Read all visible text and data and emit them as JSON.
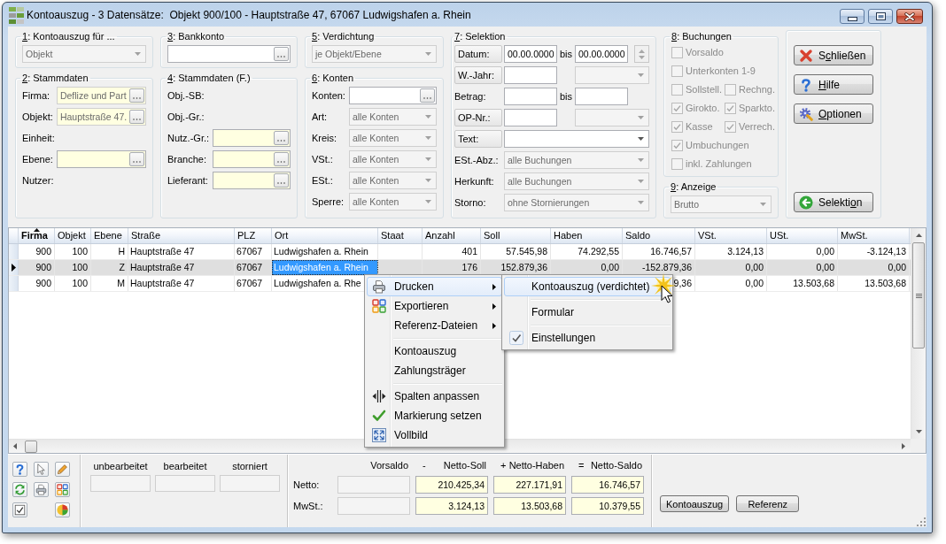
{
  "window": {
    "title": "Kontoauszug - 3 Datensätze:  Objekt 900/100 - Hauptstraße 47, 67067 Ludwigshafen a. Rhein"
  },
  "filter_columns": [
    {
      "groups": [
        {
          "title": {
            "key": "1",
            "post": ": Kontoauszug für ..."
          },
          "rows": [
            {
              "kind": "dropdown",
              "value": "Objekt",
              "disabled": true
            }
          ]
        },
        {
          "title": {
            "key": "2",
            "post": ": Stammdaten"
          },
          "rows": [
            {
              "kind": "lookup",
              "label": "Firma:",
              "value": "Deflize und Part",
              "highlighted": true,
              "disabled": true
            },
            {
              "kind": "lookup",
              "label": "Objekt:",
              "value": "Hauptstraße 47.",
              "highlighted": true,
              "disabled": true
            },
            {
              "kind": "label",
              "label": "Einheit:"
            },
            {
              "kind": "lookup",
              "label": "Ebene:",
              "highlighted": true,
              "disabled": false
            },
            {
              "kind": "label",
              "label": "Nutzer:"
            }
          ]
        }
      ]
    },
    {
      "groups": [
        {
          "title": {
            "key": "3",
            "post": ": Bankkonto"
          },
          "rows": [
            {
              "kind": "lookup",
              "highlighted": false,
              "disabled": false
            }
          ]
        },
        {
          "title": {
            "key": "4",
            "post": ": Stammdaten (F.)"
          },
          "rows": [
            {
              "kind": "label",
              "label": "Obj.-SB:"
            },
            {
              "kind": "label",
              "label": "Obj.-Gr.:"
            },
            {
              "kind": "lookup",
              "label": "Nutz.-Gr.:",
              "highlighted": true,
              "disabled": false
            },
            {
              "kind": "lookup",
              "label": "Branche:",
              "highlighted": true,
              "disabled": false
            },
            {
              "kind": "lookup",
              "label": "Lieferant:",
              "highlighted": true,
              "disabled": false
            }
          ]
        }
      ]
    },
    {
      "groups": [
        {
          "title": {
            "key": "5",
            "post": ": Verdichtung"
          },
          "rows": [
            {
              "kind": "dropdown",
              "value": "je Objekt/Ebene",
              "disabled": true
            }
          ]
        },
        {
          "title": {
            "key": "6",
            "post": ": Konten"
          },
          "rows": [
            {
              "kind": "lookup",
              "label": "Konten:",
              "highlighted": false,
              "disabled": false
            },
            {
              "kind": "dropdown",
              "label": "Art:",
              "value": "alle Konten",
              "disabled": true
            },
            {
              "kind": "dropdown",
              "label": "Kreis:",
              "value": "alle Konten",
              "disabled": true
            },
            {
              "kind": "dropdown",
              "label": "VSt.:",
              "value": "alle Konten",
              "disabled": true
            },
            {
              "kind": "dropdown",
              "label": "ESt.:",
              "value": "alle Konten",
              "disabled": true
            },
            {
              "kind": "dropdown",
              "label": "Sperre:",
              "value": "alle Konten",
              "disabled": true
            }
          ]
        }
      ]
    },
    {
      "groups": [
        {
          "title": {
            "key": "7",
            "post": ": Selektion"
          },
          "rows": [
            {
              "kind": "selection",
              "label": "Datum:",
              "label_button": true,
              "fields": [
                {
                  "kind": "text",
                  "value": "00.00.0000"
                },
                {
                  "kind": "until",
                  "text": "bis"
                },
                {
                  "kind": "text",
                  "value": "00.00.0000"
                },
                {
                  "kind": "spinner",
                  "disabled": true
                }
              ]
            },
            {
              "kind": "selection",
              "label": "W.-Jahr:",
              "label_button": true,
              "fields": [
                {
                  "kind": "text"
                },
                {
                  "kind": "dropdown",
                  "disabled": true
                }
              ]
            },
            {
              "kind": "selection",
              "label": "Betrag:",
              "label_button": false,
              "fields": [
                {
                  "kind": "text"
                },
                {
                  "kind": "until",
                  "text": "bis"
                },
                {
                  "kind": "text"
                }
              ]
            },
            {
              "kind": "selection",
              "label": "OP-Nr.:",
              "label_button": true,
              "fields": [
                {
                  "kind": "text"
                },
                {
                  "kind": "dropdown",
                  "disabled": true
                }
              ]
            },
            {
              "kind": "selection",
              "label": "Text:",
              "label_button": true,
              "fields": [
                {
                  "kind": "dropdown",
                  "disabled": false
                }
              ]
            },
            {
              "kind": "selection",
              "label": "ESt.-Abz.:",
              "label_button": false,
              "fields": [
                {
                  "kind": "dropdown",
                  "value": "alle Buchungen",
                  "disabled": true
                }
              ]
            },
            {
              "kind": "selection",
              "label": "Herkunft:",
              "label_button": false,
              "fields": [
                {
                  "kind": "dropdown",
                  "value": "alle Buchungen",
                  "disabled": true
                }
              ]
            },
            {
              "kind": "selection",
              "label": "Storno:",
              "label_button": false,
              "fields": [
                {
                  "kind": "dropdown",
                  "value": "ohne Stornierungen",
                  "disabled": true
                }
              ]
            }
          ]
        }
      ]
    },
    {
      "groups": [
        {
          "title": {
            "key": "8",
            "post": ": Buchungen"
          },
          "rows": [
            {
              "kind": "checks",
              "items": [
                {
                  "label": "Vorsaldo",
                  "checked": false,
                  "disabled": true
                }
              ]
            },
            {
              "kind": "checks",
              "items": [
                {
                  "label": "Unterkonten 1-9",
                  "checked": false,
                  "disabled": true
                }
              ]
            },
            {
              "kind": "checks",
              "items": [
                {
                  "label": "Sollstell.",
                  "checked": false,
                  "disabled": true
                },
                {
                  "label": "Rechng.",
                  "checked": false,
                  "disabled": true
                }
              ]
            },
            {
              "kind": "checks",
              "items": [
                {
                  "label": "Girokto.",
                  "checked": true,
                  "disabled": true
                },
                {
                  "label": "Sparkto.",
                  "checked": true,
                  "disabled": true
                }
              ]
            },
            {
              "kind": "checks",
              "items": [
                {
                  "label": "Kasse",
                  "checked": true,
                  "disabled": true
                },
                {
                  "label": "Verrech.",
                  "checked": true,
                  "disabled": true
                }
              ]
            },
            {
              "kind": "checks",
              "items": [
                {
                  "label": "Umbuchungen",
                  "checked": true,
                  "disabled": true
                }
              ]
            },
            {
              "kind": "checks",
              "items": [
                {
                  "label": "inkl. Zahlungen",
                  "checked": false,
                  "disabled": true
                }
              ]
            }
          ]
        },
        {
          "title": {
            "key": "9",
            "post": ": Anzeige"
          },
          "rows": [
            {
              "kind": "dropdown",
              "value": "Brutto",
              "disabled": true
            }
          ]
        }
      ]
    }
  ],
  "actions": {
    "top": [
      {
        "kind": "close",
        "label": {
          "pre": "S",
          "key": "c",
          "post": "hließen"
        }
      },
      {
        "kind": "help",
        "label": {
          "key": "H",
          "post": "ilfe"
        }
      },
      {
        "kind": "options",
        "label": {
          "key": "O",
          "post": "ptionen"
        }
      }
    ],
    "bottom": [
      {
        "kind": "back",
        "label": {
          "pre": "Selekti",
          "key": "o",
          "post": "n"
        }
      }
    ]
  },
  "table": {
    "columns": [
      {
        "label": "Firma",
        "sorted": true,
        "selected": false
      },
      {
        "label": "Objekt",
        "sorted": false,
        "selected": false
      },
      {
        "label": "Ebene",
        "sorted": false,
        "selected": false
      },
      {
        "label": "Straße",
        "sorted": false,
        "selected": false
      },
      {
        "label": "PLZ",
        "sorted": false,
        "selected": false
      },
      {
        "label": "Ort",
        "sorted": false,
        "selected": true
      },
      {
        "label": "Staat",
        "sorted": false,
        "selected": false
      },
      {
        "label": "Anzahl",
        "sorted": false,
        "selected": false
      },
      {
        "label": "Soll",
        "sorted": false,
        "selected": false
      },
      {
        "label": "Haben",
        "sorted": false,
        "selected": false
      },
      {
        "label": "Saldo",
        "sorted": false,
        "selected": false
      },
      {
        "label": "VSt.",
        "sorted": false,
        "selected": false
      },
      {
        "label": "USt.",
        "sorted": false,
        "selected": false
      },
      {
        "label": "MwSt.",
        "sorted": false,
        "selected": false
      }
    ],
    "rows": [
      {
        "current": false,
        "selected": false,
        "cells": [
          "900",
          "100",
          "H",
          "Hauptstraße 47",
          "67067",
          "Ludwigshafen a. Rhein",
          null,
          "401",
          "57.545,98",
          "74.292,55",
          "16.746,57",
          "3.124,13",
          "0,00",
          "-3.124,13"
        ]
      },
      {
        "current": true,
        "selected": true,
        "cells": [
          "900",
          "100",
          "Z",
          "Hauptstraße 47",
          "67067",
          "Ludwigshafen a. Rhein",
          null,
          "176",
          "152.879,36",
          "0,00",
          "-152.879,36",
          "0,00",
          "0,00",
          "0,00"
        ]
      },
      {
        "current": false,
        "selected": false,
        "cells": [
          "900",
          "100",
          "M",
          "Hauptstraße 47",
          "67067",
          "Ludwigshafen a. Rhe",
          null,
          null,
          null,
          null,
          "9,36",
          "0,00",
          "13.503,68",
          "13.503,68"
        ]
      }
    ]
  },
  "context_menu": {
    "sections": [
      {
        "items": [
          {
            "kind": "print",
            "label": "Drucken",
            "submenu": true,
            "selected": true
          },
          {
            "kind": "export",
            "label": "Exportieren",
            "submenu": true,
            "selected": false
          },
          {
            "kind": "plain",
            "label": "Referenz-Dateien",
            "submenu": true,
            "selected": false
          }
        ]
      },
      {
        "items": [
          {
            "kind": "plain",
            "label": "Kontoauszug",
            "submenu": false,
            "selected": false
          },
          {
            "kind": "plain",
            "label": "Zahlungsträger",
            "submenu": false,
            "selected": false
          }
        ]
      },
      {
        "items": [
          {
            "kind": "columns",
            "label": "Spalten anpassen",
            "submenu": false,
            "selected": false
          },
          {
            "kind": "mark",
            "label": "Markierung setzen",
            "submenu": false,
            "selected": false
          },
          {
            "kind": "fullscreen",
            "label": "Vollbild",
            "submenu": false,
            "selected": false
          }
        ]
      }
    ]
  },
  "submenu": {
    "sections": [
      {
        "items": [
          {
            "label": "Kontoauszug (verdichtet)",
            "selected": true,
            "checked": false
          }
        ]
      },
      {
        "items": [
          {
            "label": "Formular",
            "selected": false,
            "checked": false
          }
        ]
      },
      {
        "items": [
          {
            "label": "Einstellungen",
            "selected": false,
            "checked": true
          }
        ]
      }
    ]
  },
  "footer": {
    "counters": [
      {
        "label": "unbearbeitet",
        "disabled": true
      },
      {
        "label": "bearbeitet",
        "disabled": true
      },
      {
        "label": "storniert",
        "disabled": true
      }
    ],
    "totals": {
      "columns": [
        {
          "label": "Vorsaldo"
        },
        {
          "sign": "-",
          "label": "Netto-Soll"
        },
        {
          "sign": "+",
          "label": "Netto-Haben"
        },
        {
          "sign": "=",
          "label": "Netto-Saldo"
        }
      ],
      "rows": [
        {
          "label": "Netto:",
          "cells": [
            {
              "highlighted": false,
              "disabled": true
            },
            {
              "value": "210.425,34",
              "highlighted": true,
              "disabled": false
            },
            {
              "value": "227.171,91",
              "highlighted": true,
              "disabled": false
            },
            {
              "value": "16.746,57",
              "highlighted": true,
              "disabled": false
            }
          ]
        },
        {
          "label": "MwSt.:",
          "cells": [
            {
              "highlighted": false,
              "disabled": true
            },
            {
              "value": "3.124,13",
              "highlighted": true,
              "disabled": false
            },
            {
              "value": "13.503,68",
              "highlighted": true,
              "disabled": false
            },
            {
              "value": "10.379,55",
              "highlighted": true,
              "disabled": false
            }
          ]
        }
      ]
    },
    "buttons": [
      "Kontoauszug",
      "Referenz"
    ]
  }
}
